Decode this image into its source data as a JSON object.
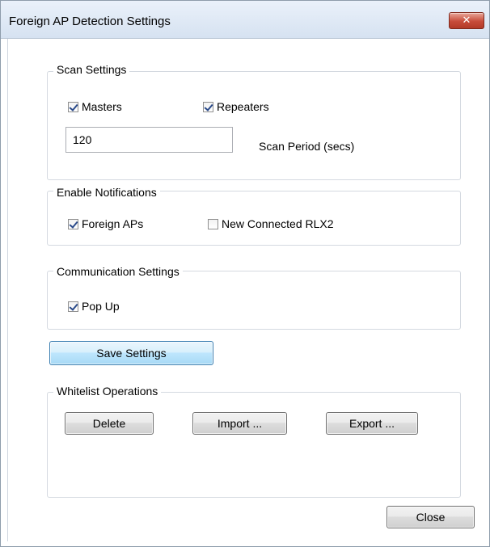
{
  "window": {
    "title": "Foreign AP Detection Settings",
    "close_glyph": "✕"
  },
  "scan_settings": {
    "group_label": "Scan Settings",
    "masters": {
      "label": "Masters",
      "checked": true
    },
    "repeaters": {
      "label": "Repeaters",
      "checked": true
    },
    "scan_period_value": "120",
    "scan_period_label": "Scan Period (secs)"
  },
  "notifications": {
    "group_label": "Enable Notifications",
    "foreign_aps": {
      "label": "Foreign APs",
      "checked": true
    },
    "new_connected": {
      "label": "New Connected RLX2",
      "checked": false
    }
  },
  "communication": {
    "group_label": "Communication Settings",
    "pop_up": {
      "label": "Pop Up",
      "checked": true
    }
  },
  "save_button": "Save Settings",
  "whitelist": {
    "group_label": "Whitelist Operations",
    "delete": "Delete",
    "import": "Import ...",
    "export": "Export ..."
  },
  "close_button": "Close"
}
